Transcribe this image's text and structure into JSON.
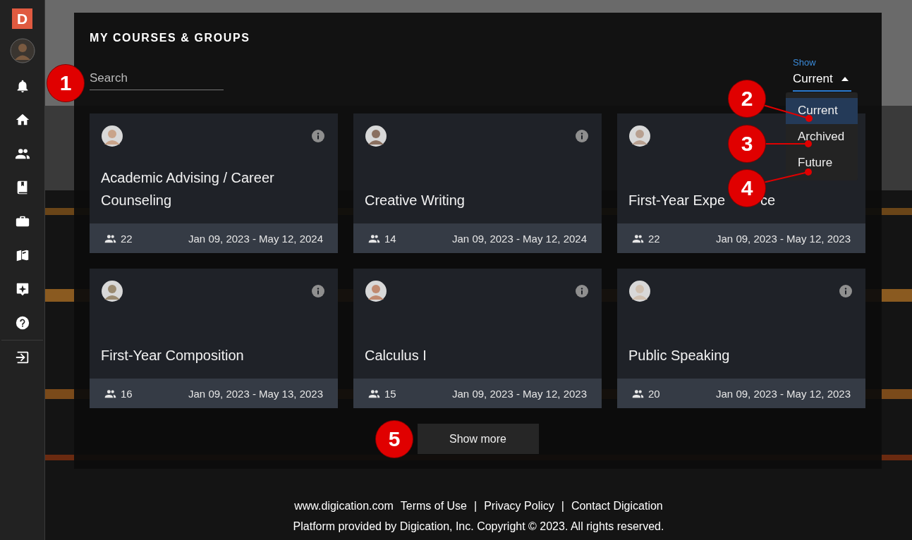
{
  "sidebar": {
    "logo": "D"
  },
  "panel": {
    "title": "MY COURSES & GROUPS",
    "search": {
      "placeholder": "Search"
    },
    "show_filter": {
      "label": "Show",
      "value": "Current",
      "expanded": true,
      "options": [
        {
          "label": "Current",
          "selected": true
        },
        {
          "label": "Archived",
          "selected": false
        },
        {
          "label": "Future",
          "selected": false
        }
      ]
    },
    "cards": [
      {
        "title": "Academic Advising / Career Counseling",
        "members": "22",
        "dates": "Jan 09, 2023 - May 12, 2024"
      },
      {
        "title": "Creative Writing",
        "members": "14",
        "dates": "Jan 09, 2023 - May 12, 2024"
      },
      {
        "title": "First-Year Expe",
        "title_end": "ce",
        "info_hidden": true,
        "members": "22",
        "dates": "Jan 09, 2023 - May 12, 2023"
      },
      {
        "title": "First-Year Composition",
        "members": "16",
        "dates": "Jan 09, 2023 - May 13, 2023"
      },
      {
        "title": "Calculus I",
        "members": "15",
        "dates": "Jan 09, 2023 - May 12, 2023"
      },
      {
        "title": "Public Speaking",
        "members": "20",
        "dates": "Jan 09, 2023 - May 12, 2023"
      }
    ],
    "show_more": "Show more"
  },
  "footer": {
    "links": [
      "www.digication.com",
      "Terms of Use",
      "Privacy Policy",
      "Contact Digication"
    ],
    "separator": "|",
    "copyright": "Platform provided by Digication, Inc. Copyright © 2023. All rights reserved."
  },
  "callouts": [
    {
      "label": "1"
    },
    {
      "label": "2"
    },
    {
      "label": "3"
    },
    {
      "label": "4"
    },
    {
      "label": "5"
    }
  ]
}
